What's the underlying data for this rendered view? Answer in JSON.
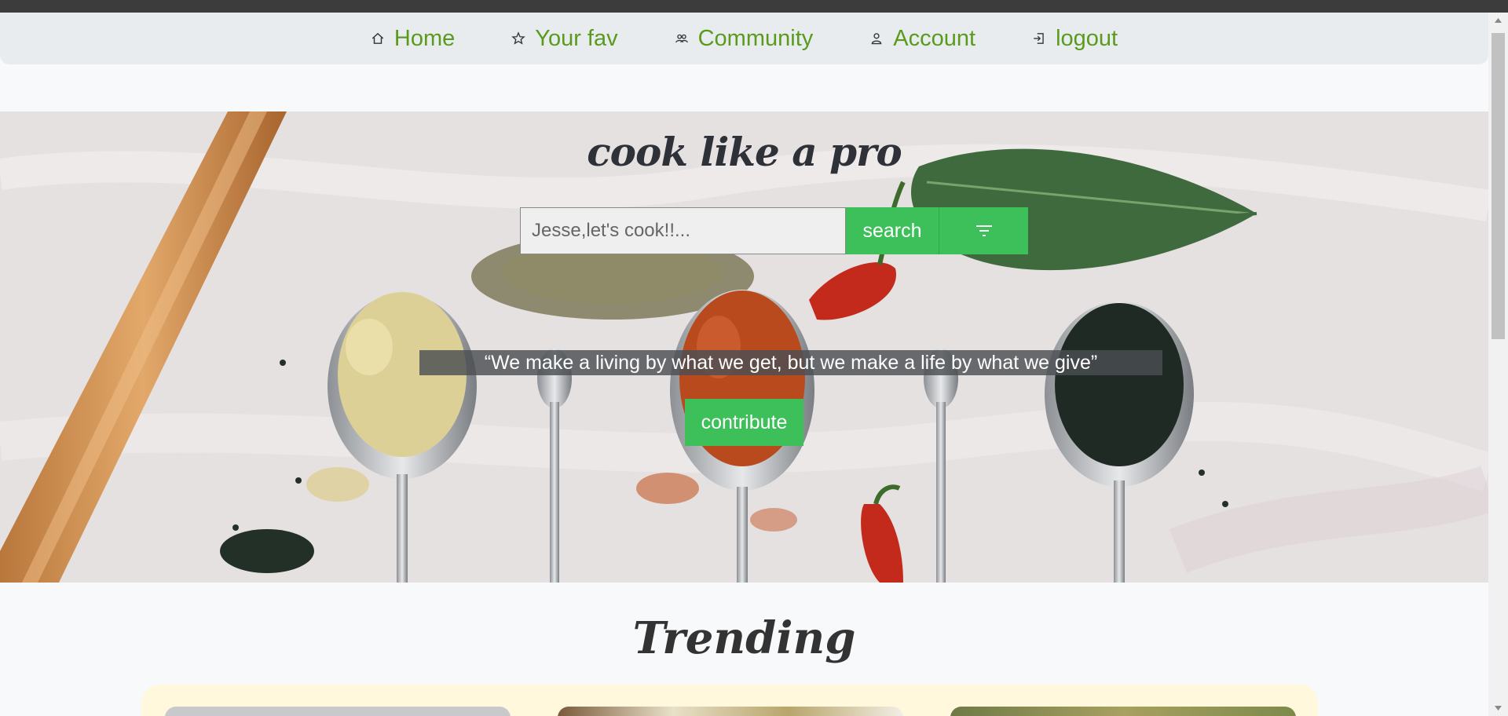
{
  "nav": {
    "items": [
      {
        "label": "Home",
        "icon": "home-icon"
      },
      {
        "label": "Your fav",
        "icon": "star-icon"
      },
      {
        "label": "Community",
        "icon": "users-icon"
      },
      {
        "label": "Account",
        "icon": "user-icon"
      },
      {
        "label": "logout",
        "icon": "logout-icon"
      }
    ]
  },
  "hero": {
    "title": "cook like a pro",
    "search_placeholder": "Jesse,let's cook!!...",
    "search_label": "search",
    "filter_icon": "filter-icon",
    "quote": "“We make a living by what we get, but we make a life by what we give”",
    "contribute_label": "contribute"
  },
  "trending": {
    "title": "Trending"
  },
  "colors": {
    "accent_green": "#3dbf5a",
    "nav_text": "#5a9b1e",
    "nav_bg": "#e9ecef",
    "trending_bg": "#fff8dc"
  }
}
